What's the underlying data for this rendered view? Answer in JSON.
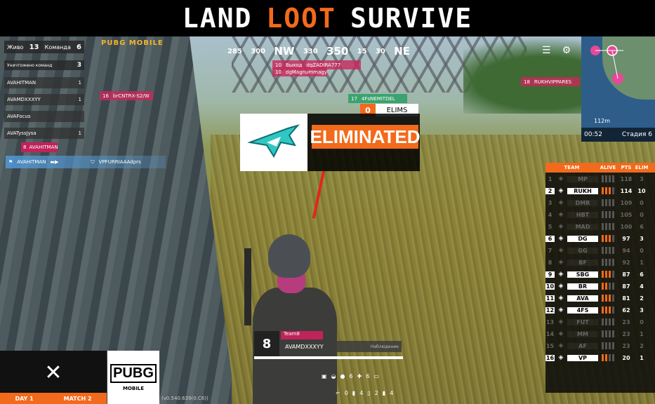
{
  "header": {
    "title_part1": "LAND",
    "title_part2": "LOOT",
    "title_part3": "SURVIVE",
    "color_white": "#ffffff",
    "color_orange": "#f26a1b"
  },
  "hud": {
    "alive_label": "Живо",
    "alive_count": "13",
    "teams_label": "Команда",
    "teams_count": "6",
    "team_elim_label": "Уничтожено команд",
    "team_elim_count": "3",
    "teammates": [
      {
        "name": "AVAHITMAN",
        "value": "1"
      },
      {
        "name": "AVAMDXXXYY",
        "value": "1"
      },
      {
        "name": "AVAFocus",
        "value": ""
      },
      {
        "name": "AVATyssJysa",
        "value": "1"
      }
    ],
    "kill_feed_num": "8",
    "kill_feed_name": "AVAHITMAN",
    "kill_feed_killer": "AVAHITMAN",
    "kill_feed_victim": "VPFURRIAAAdprs",
    "pubg_small": "PUBG MOBILE"
  },
  "compass": {
    "a": "285",
    "b": "300",
    "c": "NW",
    "d": "330",
    "e": "350",
    "f": "15",
    "g": "30",
    "h": "NE"
  },
  "name_tags": [
    {
      "num": "10",
      "name": "Выход",
      "sub": "dgZADIRA777"
    },
    {
      "num": "10",
      "name": "dgMagnummagy",
      "sub": ""
    },
    {
      "num": "16",
      "name": "brCNTRX-S2/W",
      "sub": ""
    },
    {
      "num": "17",
      "name": "4FsNEMITDEL",
      "sub": ""
    },
    {
      "num": "18",
      "name": "RUKHVIPPARES",
      "sub": ""
    }
  ],
  "elim_banner": {
    "count": "0",
    "count_label": "ELIMS",
    "text": "ELIMINATED"
  },
  "map": {
    "distance": "112m",
    "timer": "00:52",
    "stage": "Стадия 6"
  },
  "scoreboard": {
    "headers": {
      "team": "TEAM",
      "alive": "ALIVE",
      "pts": "PTS",
      "elim": "ELIM"
    },
    "rows": [
      {
        "rank": "1",
        "team": "MP",
        "alive": 0,
        "pts": "118",
        "elim": "3"
      },
      {
        "rank": "2",
        "team": "RUKH",
        "alive": 3,
        "pts": "114",
        "elim": "10"
      },
      {
        "rank": "3",
        "team": "DMR",
        "alive": 0,
        "pts": "109",
        "elim": "0"
      },
      {
        "rank": "4",
        "team": "HBT",
        "alive": 0,
        "pts": "105",
        "elim": "0"
      },
      {
        "rank": "5",
        "team": "MAD",
        "alive": 0,
        "pts": "100",
        "elim": "6"
      },
      {
        "rank": "6",
        "team": "DG",
        "alive": 3,
        "pts": "97",
        "elim": "3"
      },
      {
        "rank": "7",
        "team": "GG",
        "alive": 0,
        "pts": "94",
        "elim": "0"
      },
      {
        "rank": "8",
        "team": "BF",
        "alive": 0,
        "pts": "92",
        "elim": "1"
      },
      {
        "rank": "9",
        "team": "SBG",
        "alive": 3,
        "pts": "87",
        "elim": "6"
      },
      {
        "rank": "10",
        "team": "BR",
        "alive": 2,
        "pts": "87",
        "elim": "4"
      },
      {
        "rank": "11",
        "team": "AVA",
        "alive": 3,
        "pts": "81",
        "elim": "2"
      },
      {
        "rank": "12",
        "team": "4FS",
        "alive": 3,
        "pts": "62",
        "elim": "3"
      },
      {
        "rank": "13",
        "team": "FUT",
        "alive": 0,
        "pts": "23",
        "elim": "0"
      },
      {
        "rank": "14",
        "team": "MM",
        "alive": 0,
        "pts": "23",
        "elim": "1"
      },
      {
        "rank": "15",
        "team": "AF",
        "alive": 0,
        "pts": "23",
        "elim": "2"
      },
      {
        "rank": "16",
        "team": "VP",
        "alive": 2,
        "pts": "20",
        "elim": "1"
      }
    ]
  },
  "bottom": {
    "day": "DAY 1",
    "match": "MATCH 2",
    "pubg": "PUBG",
    "mobile": "MOBILE",
    "scroll_text": "(v0.540.639(0.C6))"
  },
  "spectate": {
    "number": "8",
    "team": "Team8",
    "name": "AVAMDXXXYY",
    "status": "Наблюдение",
    "ammo1": "6",
    "ammo2": "6",
    "ammo3": "0",
    "ammo4": "4",
    "ammo5": "2",
    "ammo6": "4"
  }
}
